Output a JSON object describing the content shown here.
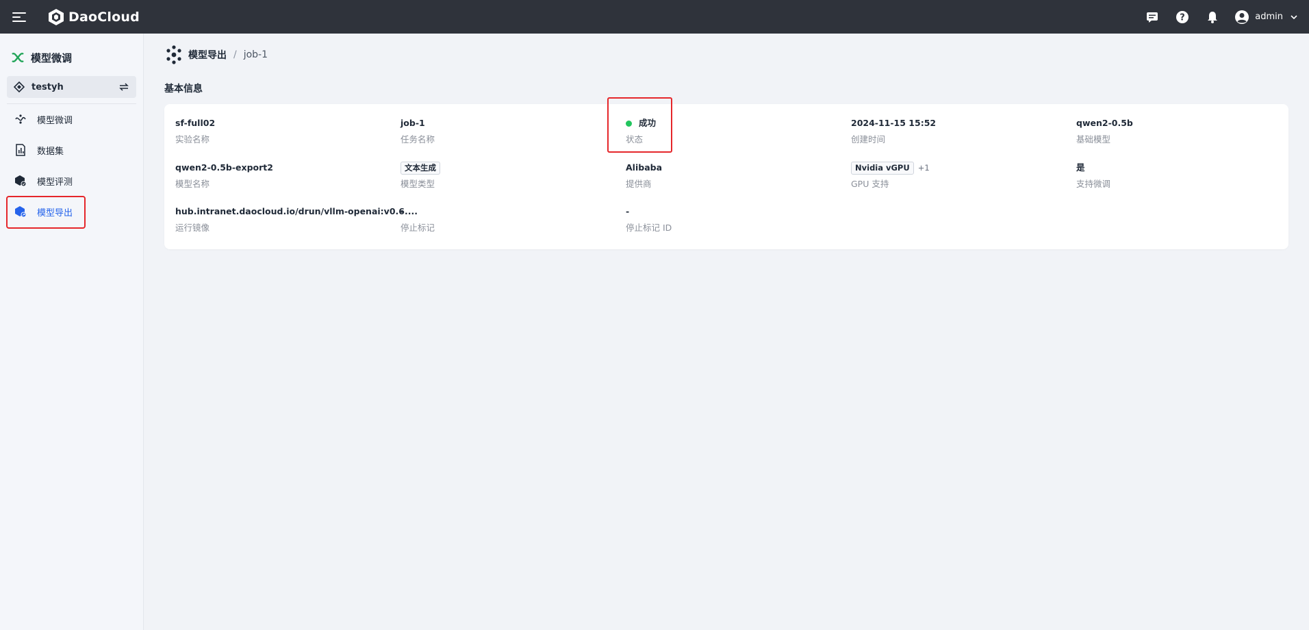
{
  "header": {
    "brand": "DaoCloud",
    "user": "admin"
  },
  "sidebar": {
    "title": "模型微调",
    "workspace": "testyh",
    "items": [
      {
        "label": "模型微调",
        "icon": "finetune-icon"
      },
      {
        "label": "数据集",
        "icon": "dataset-icon"
      },
      {
        "label": "模型评测",
        "icon": "evaluate-icon"
      },
      {
        "label": "模型导出",
        "icon": "export-icon",
        "active": true
      }
    ]
  },
  "breadcrumb": {
    "parent": "模型导出",
    "separator": "/",
    "current": "job-1"
  },
  "section": {
    "title": "基本信息"
  },
  "fields": {
    "experiment_name": {
      "value": "sf-full02",
      "label": "实验名称"
    },
    "task_name": {
      "value": "job-1",
      "label": "任务名称"
    },
    "status": {
      "value": "成功",
      "label": "状态",
      "color": "#22c55e"
    },
    "created_time": {
      "value": "2024-11-15 15:52",
      "label": "创建时间"
    },
    "base_model": {
      "value": "qwen2-0.5b",
      "label": "基础模型"
    },
    "model_name": {
      "value": "qwen2-0.5b-export2",
      "label": "模型名称"
    },
    "model_type": {
      "value": "文本生成",
      "label": "模型类型"
    },
    "provider": {
      "value": "Alibaba",
      "label": "提供商"
    },
    "gpu_support": {
      "value": "Nvidia vGPU",
      "extra": "+1",
      "label": "GPU 支持"
    },
    "support_finetune": {
      "value": "是",
      "label": "支持微调"
    },
    "run_image": {
      "value": "hub.intranet.daocloud.io/drun/vllm-openai:v0.6....",
      "label": "运行镜像"
    },
    "stop_mark": {
      "value": "-",
      "label": "停止标记"
    },
    "stop_mark_id": {
      "value": "-",
      "label": "停止标记 ID"
    }
  },
  "colors": {
    "topbar": "#2f333b",
    "accent": "#2563eb",
    "highlight": "#e5262a",
    "logo_green": "#22c55e"
  }
}
